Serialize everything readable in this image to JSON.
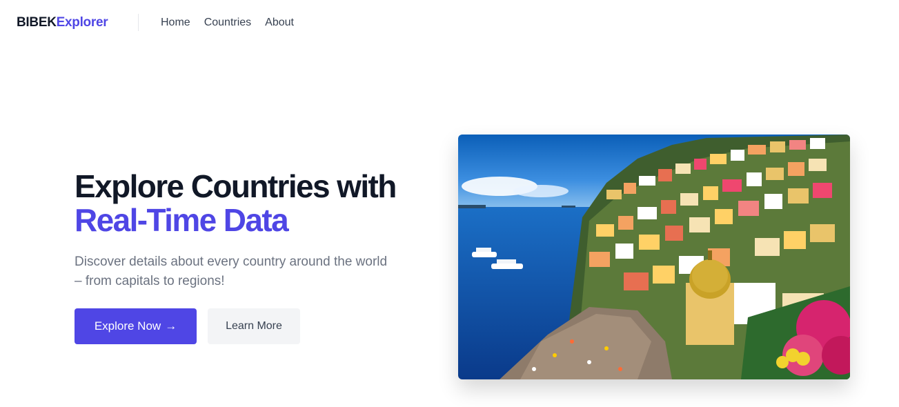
{
  "navbar": {
    "logo_part1": "BIBEK",
    "logo_part2": "Explorer",
    "links": [
      "Home",
      "Countries",
      "About"
    ]
  },
  "hero": {
    "title_line1": "Explore Countries with",
    "title_line2": "Real-Time Data",
    "subtitle": "Discover details about every country around the world – from capitals to regions!",
    "primary_button": "Explore Now",
    "primary_button_icon": "→",
    "secondary_button": "Learn More",
    "image_description_icon": "coastal-town-photo"
  },
  "colors": {
    "accent": "#4f46e5",
    "text_dark": "#111827",
    "text_muted": "#6b7280",
    "secondary_bg": "#f3f4f6"
  }
}
